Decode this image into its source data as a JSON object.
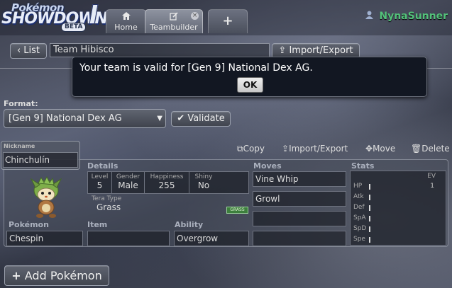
{
  "header": {
    "logo": {
      "line1": "Pokémon",
      "line2": "SHOWDOWN",
      "badge": "BETA"
    },
    "tabs": [
      {
        "label": "Home",
        "icon": "home-icon"
      },
      {
        "label": "Teambuilder",
        "icon": "edit-icon",
        "close": "×"
      },
      {
        "label": "+",
        "icon": "plus-icon"
      }
    ],
    "username": "NynaSunner",
    "username_color": "#53c17a"
  },
  "toolbar": {
    "list_label": "List",
    "team_name": "Team Hibisco",
    "import_export_label": "Import/Export"
  },
  "modal": {
    "message": "Your team is valid for [Gen 9] National Dex AG.",
    "ok_label": "OK"
  },
  "format": {
    "label": "Format:",
    "selected": "[Gen 9] National Dex AG",
    "validate_label": "Validate"
  },
  "set": {
    "nickname_label": "Nickname",
    "nickname": "Chinchulín",
    "actions": {
      "copy": "Copy",
      "import_export": "Import/Export",
      "move": "Move",
      "delete": "Delete"
    },
    "details_label": "Details",
    "details": [
      {
        "key": "Level",
        "value": "5"
      },
      {
        "key": "Gender",
        "value": "Male"
      },
      {
        "key": "Happiness",
        "value": "255"
      },
      {
        "key": "Shiny",
        "value": "No"
      }
    ],
    "tera_label": "Tera Type",
    "tera_value": "Grass",
    "tera_badge": "GRASS",
    "pokemon_label": "Pokémon",
    "pokemon": "Chespin",
    "item_label": "Item",
    "item": "",
    "ability_label": "Ability",
    "ability": "Overgrow",
    "moves_label": "Moves",
    "moves": [
      "Vine Whip",
      "Growl",
      "",
      ""
    ],
    "stats_label": "Stats",
    "ev_header": "EV",
    "stats": [
      {
        "name": "HP",
        "ev": "1"
      },
      {
        "name": "Atk",
        "ev": ""
      },
      {
        "name": "Def",
        "ev": ""
      },
      {
        "name": "SpA",
        "ev": ""
      },
      {
        "name": "SpD",
        "ev": ""
      },
      {
        "name": "Spe",
        "ev": ""
      }
    ]
  },
  "add_pokemon_label": "Add Pokémon"
}
